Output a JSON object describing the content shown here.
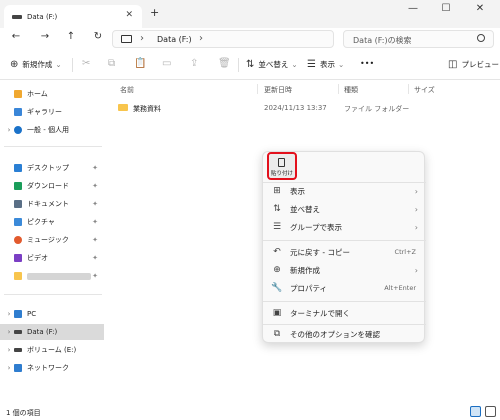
{
  "window": {
    "tab_title": "Data (F:)",
    "new_tab": "+",
    "minimize": "—",
    "maximize": "☐",
    "close": "✕",
    "tab_close": "✕"
  },
  "nav": {
    "back": "←",
    "forward": "→",
    "up": "↑",
    "refresh": "↻",
    "address": "Data (F:)",
    "sep": "›",
    "search_placeholder": "Data (F:)の検索"
  },
  "toolbar": {
    "new": "新規作成",
    "new_arrow": "⌄",
    "sort": "並べ替え",
    "view": "表示",
    "more": "•••",
    "preview": "プレビュー"
  },
  "sidebar": {
    "home": "ホーム",
    "gallery": "ギャラリー",
    "onedrive": "一般 - 個人用",
    "desktop": "デスクトップ",
    "downloads": "ダウンロード",
    "documents": "ドキュメント",
    "pictures": "ピクチャ",
    "music": "ミュージック",
    "videos": "ビデオ",
    "pc": "PC",
    "data": "Data (F:)",
    "volume": "ボリューム (E:)",
    "network": "ネットワーク",
    "pin": "📌",
    "chevron": "›"
  },
  "columns": {
    "name": "名前",
    "modified": "更新日時",
    "type": "種類",
    "size": "サイズ"
  },
  "files": [
    {
      "name": "業務資料",
      "modified": "2024/11/13 13:37",
      "type": "ファイル フォルダー"
    }
  ],
  "status": {
    "count": "1 個の項目"
  },
  "context_menu": {
    "paste": "貼り付け",
    "items": [
      {
        "label": "表示",
        "icon": "grid-icon",
        "glyph": "⊞",
        "arrow": "›"
      },
      {
        "label": "並べ替え",
        "icon": "sort-icon",
        "glyph": "⇅",
        "arrow": "›"
      },
      {
        "label": "グループで表示",
        "icon": "group-icon",
        "glyph": "☰",
        "arrow": "›"
      },
      {
        "label": "元に戻す - コピー",
        "icon": "undo-icon",
        "glyph": "↶",
        "shortcut": "Ctrl+Z"
      },
      {
        "label": "新規作成",
        "icon": "new-icon",
        "glyph": "⊕",
        "arrow": "›"
      },
      {
        "label": "プロパティ",
        "icon": "wrench-icon",
        "glyph": "🔧",
        "shortcut": "Alt+Enter"
      },
      {
        "label": "ターミナルで開く",
        "icon": "terminal-icon",
        "glyph": "▣"
      },
      {
        "label": "その他のオプションを確認",
        "icon": "more-options-icon",
        "glyph": "⧉"
      }
    ]
  },
  "colors": {
    "highlight_border": "#e3101c",
    "folder": "#f8c54d",
    "selected": "#dadada"
  }
}
